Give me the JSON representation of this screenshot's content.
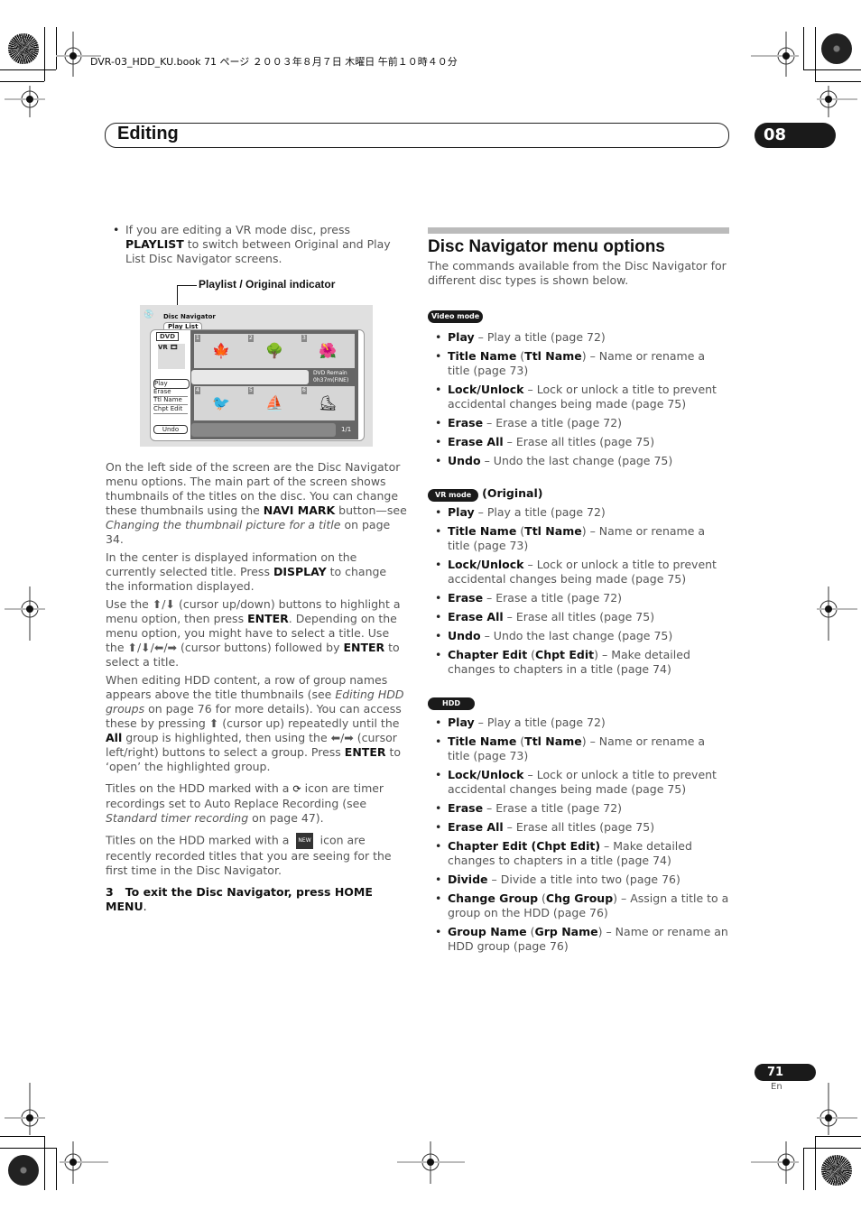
{
  "print_header": "DVR-03_HDD_KU.book 71 ページ ２００３年８月７日 木曜日 午前１０時４０分",
  "chapter": {
    "title": "Editing",
    "number": "08"
  },
  "left": {
    "bullet": {
      "pre": "If you are editing a VR mode disc, press ",
      "bold": "PLAYLIST",
      "post": " to switch between Original and Play List Disc Navigator screens."
    },
    "caption": "Playlist / Original indicator",
    "screen": {
      "title": "Disc Navigator",
      "tab": "Play List",
      "disc_label": "DVD",
      "disc_mode": "VR",
      "menu": [
        "Play",
        "Erase",
        "Ttl Name",
        "Chpt Edit"
      ],
      "undo": "Undo",
      "remain_label": "DVD Remain",
      "remain_value": "0h37m(FINE)",
      "page": "1/1",
      "thumbnails": [
        {
          "n": "1",
          "icon": "leaf-icon",
          "glyph": "🍁"
        },
        {
          "n": "2",
          "icon": "tree-icon",
          "glyph": "🌳"
        },
        {
          "n": "3",
          "icon": "flower-icon",
          "glyph": "🌺"
        },
        {
          "n": "4",
          "icon": "toucan-icon",
          "glyph": "🐦"
        },
        {
          "n": "5",
          "icon": "windsurf-icon",
          "glyph": "⛵"
        },
        {
          "n": "6",
          "icon": "skater-icon",
          "glyph": "⛸"
        }
      ]
    },
    "p1": {
      "a": "On the left side of the screen are the Disc Navigator menu options. The main part of the screen shows thumbnails of the titles on the disc. You can change these thumbnails using the ",
      "b": "NAVI MARK",
      "c": " button—see ",
      "i": "Changing the thumbnail picture for a title",
      "d": " on page 34."
    },
    "p2": {
      "a": "In the center is displayed information on the currently selected title. Press ",
      "b": "DISPLAY",
      "c": " to change the information displayed."
    },
    "p3": {
      "a": "Use the ⬆/⬇ (cursor up/down) buttons to highlight a menu option, then press ",
      "b": "ENTER",
      "c": ". Depending on the menu option, you might have to select a title. Use the ⬆/⬇/⬅/➡ (cursor buttons) followed by ",
      "b2": "ENTER",
      "d": " to select a title."
    },
    "p4": {
      "a": "When editing HDD content, a row of group names appears above the title thumbnails (see ",
      "i": "Editing HDD groups",
      "b": " on page 76 for more details). You can access these by pressing ⬆ (cursor up) repeatedly until the ",
      "bold1": "All",
      "c": " group is highlighted, then using the ⬅/➡ (cursor left/right) buttons to select a group. Press ",
      "bold2": "ENTER",
      "d": " to ‘open’ the highlighted group."
    },
    "p5": {
      "a": "Titles on the HDD marked with a ",
      "icon": "⟳",
      "b": " icon are timer recordings set to Auto Replace Recording (see ",
      "i": "Standard timer recording",
      "c": " on page 47)."
    },
    "p6": {
      "a": "Titles on the HDD marked with a ",
      "icon": "NEW",
      "b": " icon are recently recorded titles that you are seeing for the first time in the Disc Navigator."
    },
    "step": {
      "num": "3",
      "text": "To exit the Disc Navigator, press HOME MENU",
      "end": "."
    }
  },
  "right": {
    "heading": "Disc Navigator menu options",
    "intro": "The commands available from the Disc Navigator for different disc types is shown below.",
    "sections": [
      {
        "badge": "Video mode",
        "suffix": "",
        "items": [
          {
            "b": "Play",
            "t": " – Play a title (page 72)"
          },
          {
            "b": "Title Name",
            "p": " (",
            "b2": "Ttl Name",
            "t": ") – Name or rename a title (page 73)"
          },
          {
            "b": "Lock/Unlock",
            "t": " – Lock or unlock a title to prevent accidental changes being made (page 75)"
          },
          {
            "b": "Erase",
            "t": " – Erase a title (page 72)"
          },
          {
            "b": "Erase All",
            "t": " – Erase all titles (page 75)"
          },
          {
            "b": "Undo",
            "t": " – Undo the last change (page 75)"
          }
        ]
      },
      {
        "badge": "VR mode",
        "suffix": "(Original)",
        "items": [
          {
            "b": "Play",
            "t": " – Play a title (page 72)"
          },
          {
            "b": "Title Name",
            "p": " (",
            "b2": "Ttl Name",
            "t": ") – Name or rename a title (page 73)"
          },
          {
            "b": "Lock/Unlock",
            "t": " – Lock or unlock a title to prevent accidental changes being made (page 75)"
          },
          {
            "b": "Erase",
            "t": " – Erase a title (page 72)"
          },
          {
            "b": "Erase All",
            "t": " – Erase all titles (page 75)"
          },
          {
            "b": "Undo",
            "t": " – Undo the last change (page 75)"
          },
          {
            "b": "Chapter Edit",
            "p": " (",
            "b2": "Chpt Edit",
            "t": ") – Make detailed changes to chapters in a title (page 74)"
          }
        ]
      },
      {
        "badge": "HDD",
        "suffix": "",
        "items": [
          {
            "b": "Play",
            "t": " – Play a title (page 72)"
          },
          {
            "b": "Title Name",
            "p": " (",
            "b2": "Ttl Name",
            "t": ") – Name or rename a title (page 73)"
          },
          {
            "b": "Lock/Unlock",
            "t": " – Lock or unlock a title to prevent accidental changes being made (page 75)"
          },
          {
            "b": "Erase",
            "t": " – Erase a title (page 72)"
          },
          {
            "b": "Erase All",
            "t": " – Erase all titles (page 75)"
          },
          {
            "b": "Chapter Edit  (Chpt Edit)",
            "t": " – Make detailed changes to chapters in a title (page 74)"
          },
          {
            "b": "Divide",
            "t": " – Divide a title into two (page 76)"
          },
          {
            "b": "Change Group",
            "p": " (",
            "b2": "Chg Group",
            "t": ") – Assign a title to a group on the HDD (page 76)"
          },
          {
            "b": "Group Name",
            "p": " (",
            "b2": "Grp Name",
            "t": ") – Name or rename an HDD group (page 76)"
          }
        ]
      }
    ]
  },
  "footer": {
    "page": "71",
    "lang": "En"
  }
}
